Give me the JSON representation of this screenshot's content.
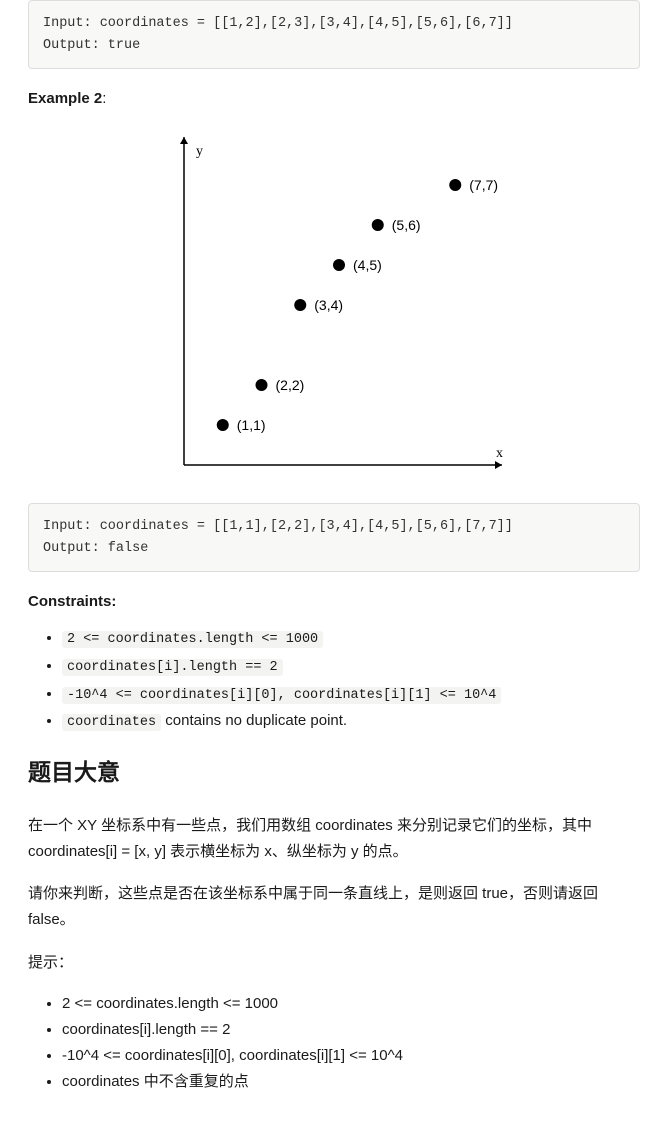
{
  "example1": {
    "code": "Input: coordinates = [[1,2],[2,3],[3,4],[4,5],[5,6],[6,7]]\nOutput: true"
  },
  "example2": {
    "label": "Example 2",
    "colon": ":",
    "code": "Input: coordinates = [[1,1],[2,2],[3,4],[4,5],[5,6],[7,7]]\nOutput: false"
  },
  "chart_data": {
    "type": "scatter",
    "title": "",
    "xlabel": "x",
    "ylabel": "y",
    "points": [
      {
        "x": 1,
        "y": 1,
        "label": "(1,1)"
      },
      {
        "x": 2,
        "y": 2,
        "label": "(2,2)"
      },
      {
        "x": 3,
        "y": 4,
        "label": "(3,4)"
      },
      {
        "x": 4,
        "y": 5,
        "label": "(4,5)"
      },
      {
        "x": 5,
        "y": 6,
        "label": "(5,6)"
      },
      {
        "x": 7,
        "y": 7,
        "label": "(7,7)"
      }
    ],
    "xlim": [
      0,
      8
    ],
    "ylim": [
      0,
      8
    ]
  },
  "constraints": {
    "label": "Constraints:",
    "items": {
      "c1": "2 <= coordinates.length <= 1000",
      "c2": "coordinates[i].length == 2",
      "c3": "-10^4 <= coordinates[i][0], coordinates[i][1] <= 10^4",
      "c4_code": "coordinates",
      "c4_text": " contains no duplicate point."
    }
  },
  "cn": {
    "heading": "题目大意",
    "para1": "在一个 XY 坐标系中有一些点，我们用数组 coordinates 来分别记录它们的坐标，其中 coordinates[i] = [x, y] 表示横坐标为 x、纵坐标为 y 的点。",
    "para2": "请你来判断，这些点是否在该坐标系中属于同一条直线上，是则返回 true，否则请返回 false。",
    "hint_label": "提示：",
    "hints": {
      "h1": "2 <= coordinates.length <= 1000",
      "h2": "coordinates[i].length == 2",
      "h3": "-10^4 <= coordinates[i][0], coordinates[i][1] <= 10^4",
      "h4": "coordinates 中不含重复的点"
    }
  }
}
